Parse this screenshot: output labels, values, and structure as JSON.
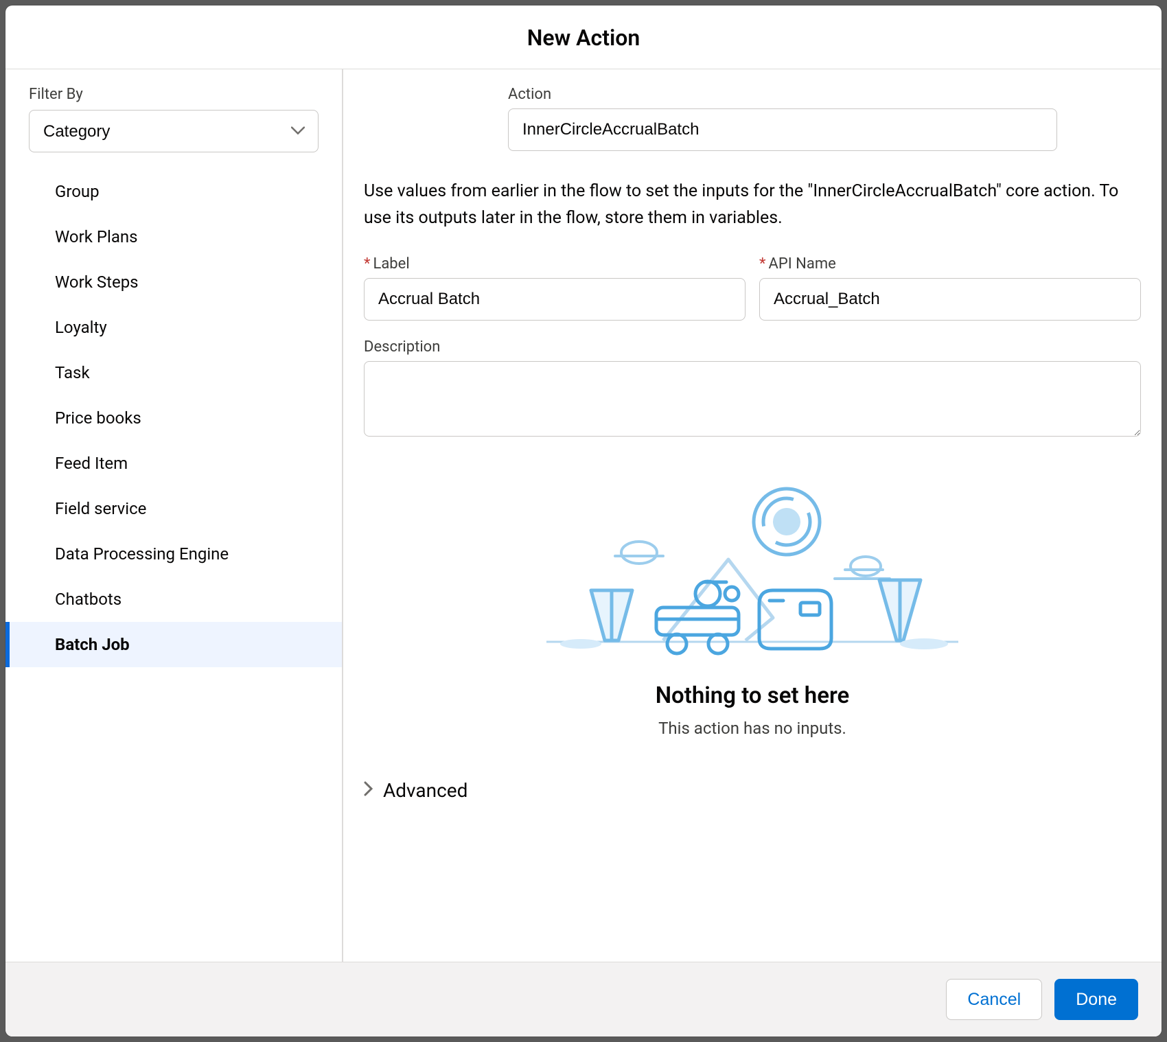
{
  "modal": {
    "title": "New Action"
  },
  "sidebar": {
    "filter_by_label": "Filter By",
    "filter_select_value": "Category",
    "categories": [
      {
        "label": "Group",
        "selected": false
      },
      {
        "label": "Work Plans",
        "selected": false
      },
      {
        "label": "Work Steps",
        "selected": false
      },
      {
        "label": "Loyalty",
        "selected": false
      },
      {
        "label": "Task",
        "selected": false
      },
      {
        "label": "Price books",
        "selected": false
      },
      {
        "label": "Feed Item",
        "selected": false
      },
      {
        "label": "Field service",
        "selected": false
      },
      {
        "label": "Data Processing Engine",
        "selected": false
      },
      {
        "label": "Chatbots",
        "selected": false
      },
      {
        "label": "Batch Job",
        "selected": true
      }
    ]
  },
  "main": {
    "action_label": "Action",
    "action_value": "InnerCircleAccrualBatch",
    "instruction": "Use values from earlier in the flow to set the inputs for the \"InnerCircleAccrualBatch\" core action. To use its outputs later in the flow, store them in variables.",
    "label_field_label": "Label",
    "label_field_value": "Accrual Batch",
    "apiname_field_label": "API Name",
    "apiname_field_value": "Accrual_Batch",
    "description_label": "Description",
    "description_value": "",
    "empty_title": "Nothing to set here",
    "empty_subtitle": "This action has no inputs.",
    "advanced_label": "Advanced"
  },
  "footer": {
    "cancel_label": "Cancel",
    "done_label": "Done"
  }
}
